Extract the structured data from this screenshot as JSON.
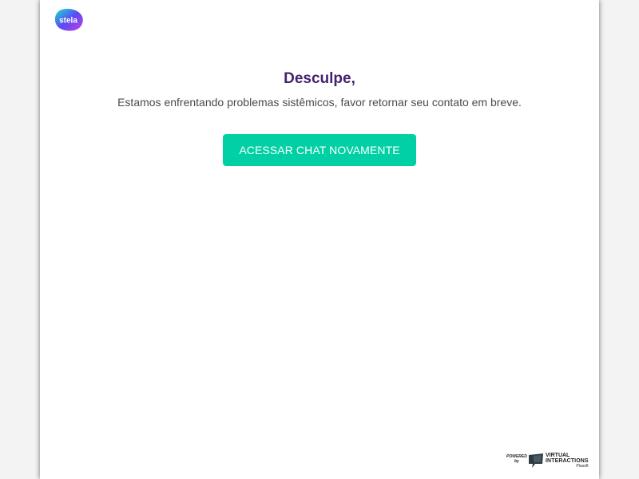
{
  "logo": {
    "text": "stela",
    "icon": "stela-logo"
  },
  "error": {
    "title": "Desculpe,",
    "message": "Estamos enfrentando problemas sistêmicos, favor retornar seu contato em breve."
  },
  "action": {
    "label": "ACESSAR CHAT NOVAMENTE"
  },
  "footer": {
    "powered": "POWERED",
    "by": "by",
    "brand_line1": "VIRTUAL",
    "brand_line2": "INTERACTIONS",
    "brand_line3": "Plusoft",
    "icon": "virtual-interactions-logo"
  },
  "colors": {
    "title": "#44226e",
    "button": "#00d0a3",
    "background": "#f3f3f3"
  }
}
